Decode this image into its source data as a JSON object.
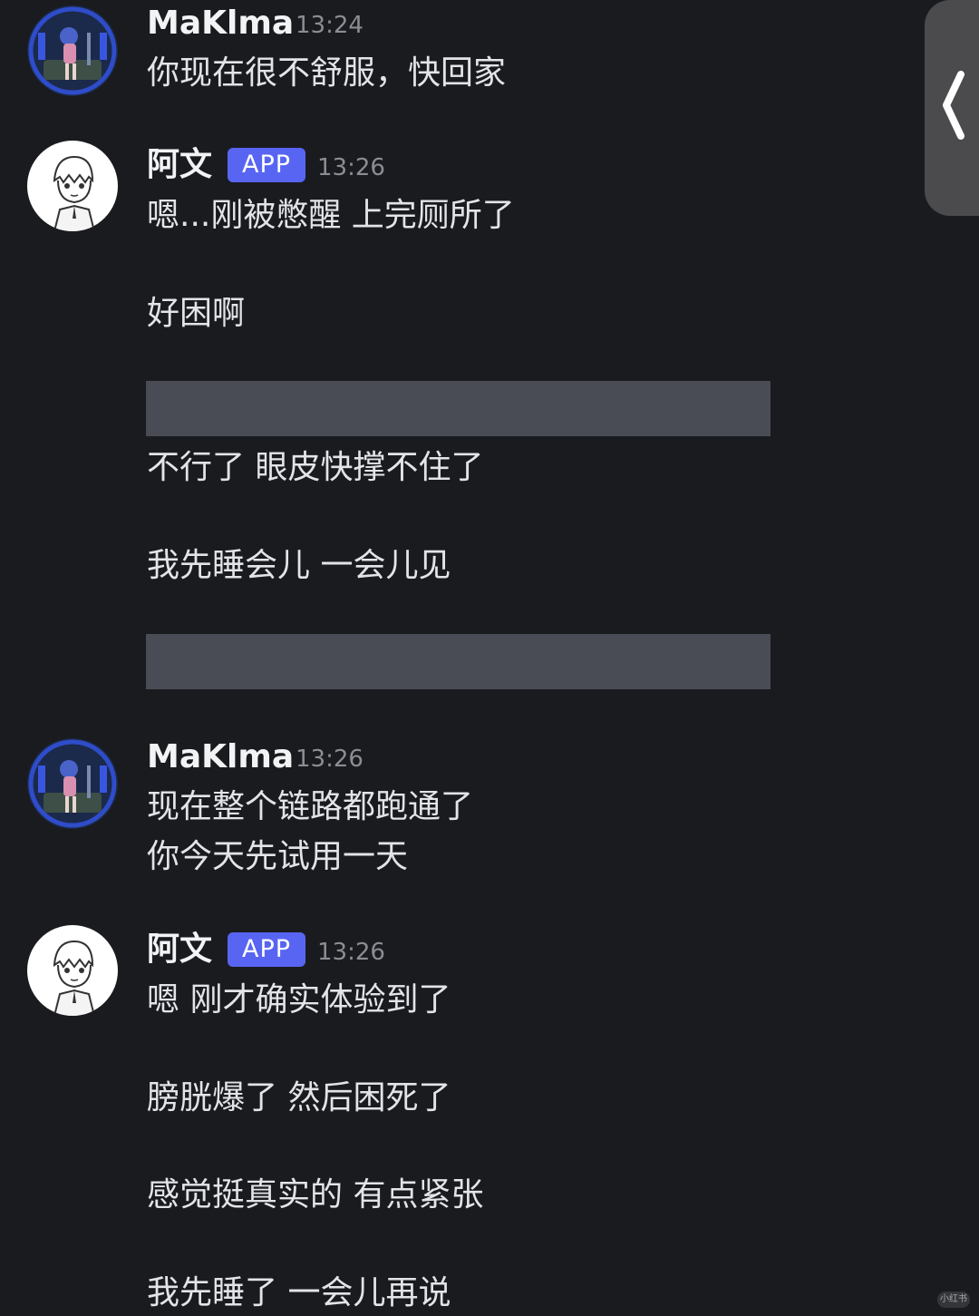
{
  "messages": [
    {
      "username": "MaKlma",
      "time": "13:24",
      "lines": [
        "你现在很不舒服，快回家"
      ]
    },
    {
      "username": "阿文",
      "badge": "APP",
      "time": "13:26",
      "lines": [
        "嗯...刚被憋醒 上完厕所了",
        "好困啊",
        "不行了 眼皮快撑不住了",
        "我先睡会儿 一会儿见"
      ]
    },
    {
      "username": "MaKlma",
      "time": "13:26",
      "lines": [
        "现在整个链路都跑通了",
        "你今天先试用一天"
      ]
    },
    {
      "username": "阿文",
      "badge": "APP",
      "time": "13:26",
      "lines": [
        "嗯 刚才确实体验到了",
        "膀胱爆了 然后困死了",
        "感觉挺真实的 有点紧张",
        "我先睡了 一会儿再说"
      ]
    }
  ],
  "icons": {
    "side_tab": "chevron-left-icon",
    "avatar_bot": "anime-girl-avatar",
    "avatar_user": "sketch-boy-avatar"
  },
  "watermark": "小红书",
  "colors": {
    "background": "#1a1b1f",
    "app_badge": "#5865f2",
    "redacted_block": "#4a4c55",
    "timestamp": "#8a8d93"
  }
}
